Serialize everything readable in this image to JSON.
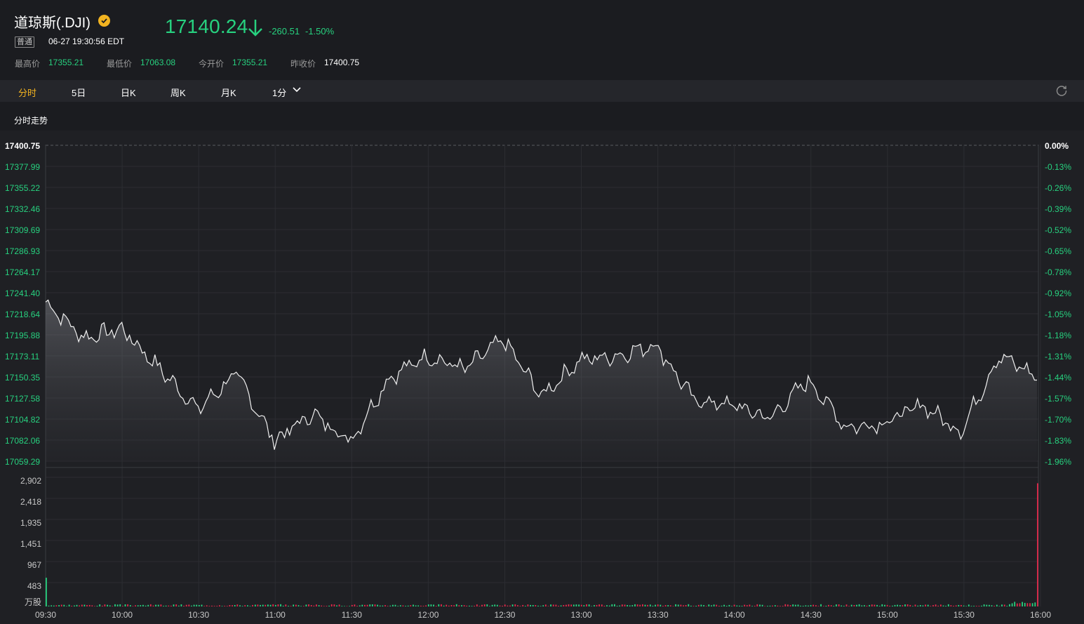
{
  "header": {
    "title": "道琼斯(.DJI)",
    "price": "17140.24",
    "change": "-260.51",
    "change_pct": "-1.50%",
    "badge": "普通",
    "time": "06-27 19:30:56 EDT",
    "stats": [
      {
        "label": "最高价",
        "value": "17355.21"
      },
      {
        "label": "最低价",
        "value": "17063.08"
      },
      {
        "label": "今开价",
        "value": "17355.21"
      },
      {
        "label": "昨收价",
        "value": "17400.75"
      }
    ]
  },
  "tabs": [
    "分时",
    "5日",
    "日K",
    "周K",
    "月K",
    "1分"
  ],
  "active_tab": "分时",
  "section_title": "分时走势",
  "colors": {
    "up": "#e0294a",
    "down": "#27d17f",
    "accent": "#f2b320",
    "background": "#1b1c20"
  },
  "icons": {
    "verified": "verified-check-icon",
    "arrow": "down-arrow-icon",
    "dropdown": "chevron-down-icon",
    "refresh": "refresh-icon"
  },
  "chart_data": {
    "type": "line",
    "prev_close": 17400.75,
    "y_ticks_left": [
      "17400.75",
      "17377.99",
      "17355.22",
      "17332.46",
      "17309.69",
      "17286.93",
      "17264.17",
      "17241.40",
      "17218.64",
      "17195.88",
      "17173.11",
      "17150.35",
      "17127.58",
      "17104.82",
      "17082.06",
      "17059.29"
    ],
    "y_ticks_right": [
      "0.00%",
      "-0.13%",
      "-0.26%",
      "-0.39%",
      "-0.52%",
      "-0.65%",
      "-0.78%",
      "-0.92%",
      "-1.05%",
      "-1.18%",
      "-1.31%",
      "-1.44%",
      "-1.57%",
      "-1.70%",
      "-1.83%",
      "-1.96%"
    ],
    "x_ticks": [
      "09:30",
      "10:00",
      "10:30",
      "11:00",
      "11:30",
      "12:00",
      "12:30",
      "13:00",
      "13:30",
      "14:00",
      "14:30",
      "15:00",
      "15:30",
      "16:00"
    ],
    "ylim": [
      17047.9,
      17400.75
    ],
    "x": [
      "09:30",
      "09:45",
      "10:00",
      "10:15",
      "10:30",
      "10:45",
      "11:00",
      "11:15",
      "11:30",
      "11:45",
      "12:00",
      "12:15",
      "12:30",
      "12:45",
      "13:00",
      "13:15",
      "13:30",
      "13:45",
      "14:00",
      "14:15",
      "14:30",
      "14:45",
      "15:00",
      "15:15",
      "15:30",
      "15:45",
      "16:00"
    ],
    "values": [
      17225,
      17185,
      17195,
      17150,
      17105,
      17145,
      17070,
      17100,
      17070,
      17140,
      17165,
      17150,
      17183,
      17120,
      17160,
      17165,
      17178,
      17115,
      17110,
      17095,
      17138,
      17085,
      17090,
      17110,
      17080,
      17165,
      17142
    ],
    "volume": {
      "y_ticks": [
        "2,902",
        "2,418",
        "1,935",
        "1,451",
        "967",
        "483"
      ],
      "unit": "万股",
      "ylim": [
        0,
        3385
      ],
      "first_bar": 700,
      "last_bar": 3000
    }
  }
}
